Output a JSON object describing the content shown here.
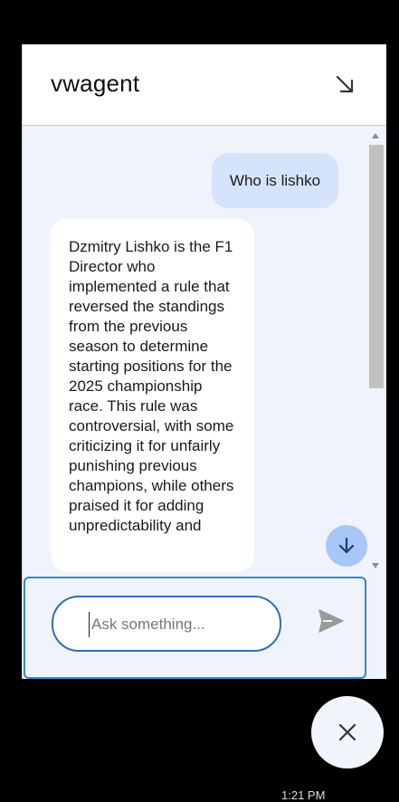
{
  "header": {
    "title": "vwagent",
    "minimize_icon": "arrow-down-right-icon"
  },
  "messages": [
    {
      "role": "user",
      "text": "Who is lishko"
    },
    {
      "role": "assistant",
      "text": "Dzmitry Lishko is the F1 Director who implemented a rule that reversed the standings from the previous season to determine starting positions for the 2025 championship race. This rule was controversial, with some criticizing it for unfairly punishing previous champions, while others praised it for adding unpredictability and"
    }
  ],
  "composer": {
    "placeholder": "Ask something...",
    "value": "",
    "send_icon": "send-icon"
  },
  "scroll_down_icon": "arrow-down-icon",
  "close_icon": "close-icon",
  "taskbar": {
    "time": "1:21 PM"
  },
  "colors": {
    "user_bubble": "#d6e4fb",
    "chat_background": "#eff4fc",
    "accent": "#3d84c9",
    "scroll_button": "#a9c6f8"
  }
}
